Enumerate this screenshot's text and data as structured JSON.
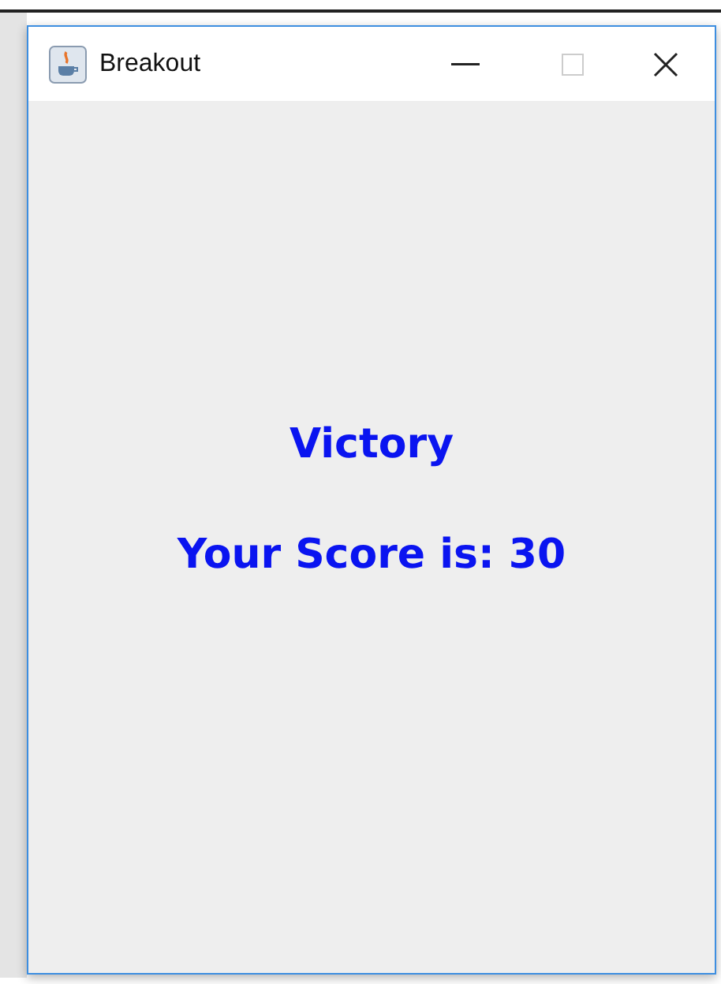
{
  "window": {
    "title": "Breakout",
    "maximize_enabled": false
  },
  "messages": [
    {
      "text": "Victory"
    },
    {
      "text": "Your Score is: 30"
    }
  ]
}
